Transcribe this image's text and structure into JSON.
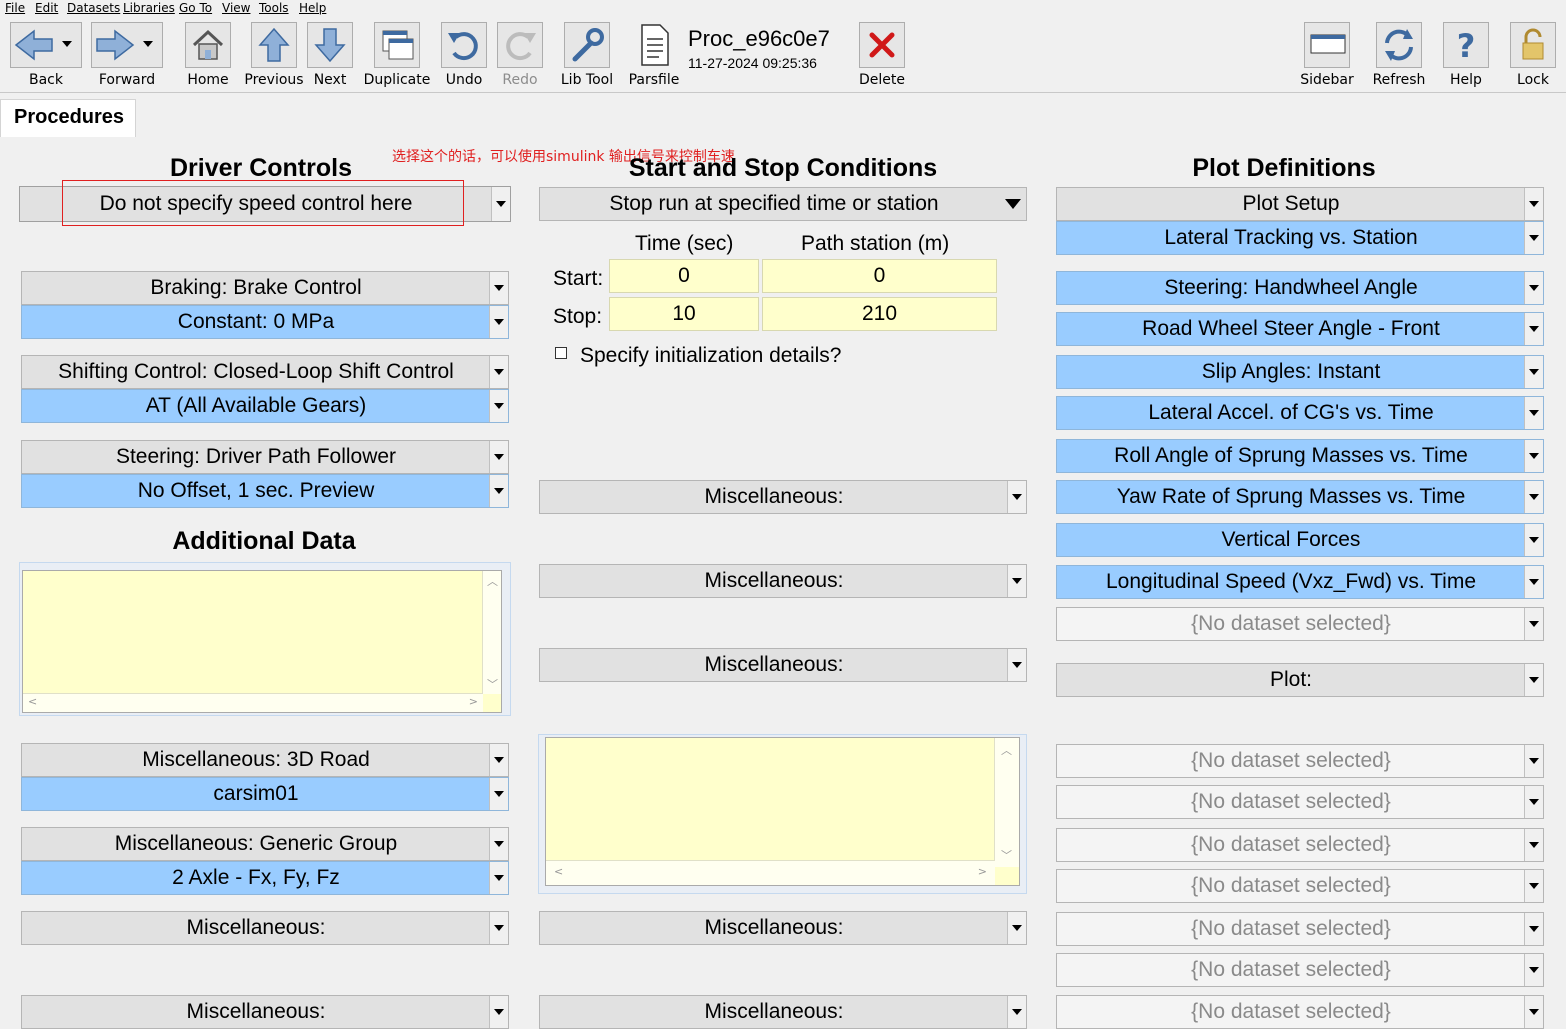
{
  "menu": [
    "File",
    "Edit",
    "Datasets",
    "Libraries",
    "Go To",
    "View",
    "Tools",
    "Help"
  ],
  "toolbar": {
    "back": "Back",
    "forward": "Forward",
    "home": "Home",
    "previous": "Previous",
    "next": "Next",
    "duplicate": "Duplicate",
    "undo": "Undo",
    "redo": "Redo",
    "libtool": "Lib Tool",
    "parsfile": "Parsfile",
    "delete": "Delete",
    "sidebar": "Sidebar",
    "refresh": "Refresh",
    "help": "Help",
    "lock": "Lock"
  },
  "dataset": {
    "title": "Proc_e96c0e7",
    "timestamp": "11-27-2024 09:25:36"
  },
  "tab": "Procedures",
  "annotation": "选择这个的话，可以使用simulink 输出信号来控制车速",
  "driver": {
    "header": "Driver Controls",
    "speed": "Do not specify speed control here",
    "braking": "Braking: Brake Control",
    "braking_ds": "Constant: 0 MPa",
    "shifting": "Shifting Control: Closed-Loop Shift Control",
    "shifting_ds": "AT (All Available Gears)",
    "steering": "Steering: Driver Path Follower",
    "steering_ds": "No Offset, 1 sec. Preview"
  },
  "additional": {
    "header": "Additional Data",
    "misc_road": "Miscellaneous: 3D Road",
    "misc_road_ds": "carsim01",
    "misc_generic": "Miscellaneous: Generic Group",
    "misc_generic_ds": "2 Axle - Fx, Fy, Fz",
    "misc1": "Miscellaneous:",
    "misc2": "Miscellaneous:"
  },
  "startstop": {
    "header": "Start and Stop Conditions",
    "mode": "Stop run at specified time or station",
    "col_time": "Time (sec)",
    "col_station": "Path station (m)",
    "start_label": "Start:",
    "stop_label": "Stop:",
    "start_time": "0",
    "start_station": "0",
    "stop_time": "10",
    "stop_station": "210",
    "init_label": "Specify initialization details?",
    "misc_a": "Miscellaneous:",
    "misc_b": "Miscellaneous:",
    "misc_c": "Miscellaneous:",
    "misc_d": "Miscellaneous:",
    "misc_e": "Miscellaneous:"
  },
  "plots": {
    "header": "Plot Definitions",
    "setup": "Plot Setup",
    "items": [
      "Lateral Tracking vs. Station",
      "Steering: Handwheel Angle",
      "Road Wheel Steer Angle - Front",
      "Slip Angles: Instant",
      "Lateral Accel. of CG's vs. Time",
      "Roll Angle of Sprung Masses vs. Time",
      "Yaw Rate of Sprung Masses vs. Time",
      "Vertical Forces",
      "Longitudinal Speed (Vxz_Fwd) vs. Time"
    ],
    "empty": "{No dataset selected}",
    "plot_label": "Plot:"
  },
  "colors": {
    "link_blue": "#99ccff",
    "field_yellow": "#ffffcc",
    "annotation_red": "#e02020"
  }
}
